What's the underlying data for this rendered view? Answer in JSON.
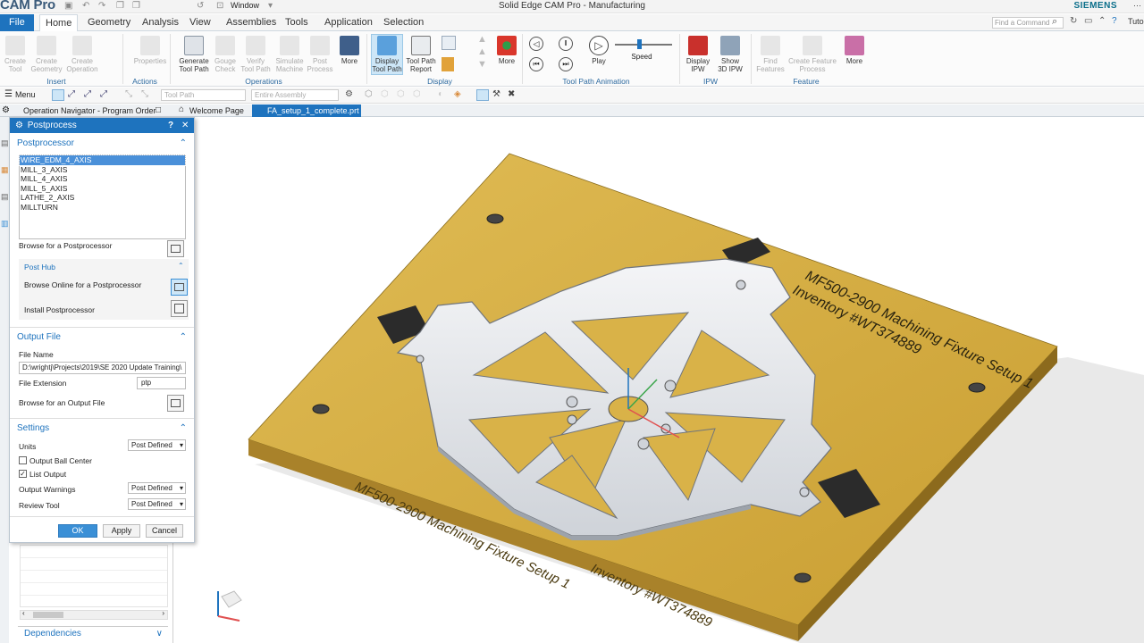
{
  "app": {
    "title": "CAM Pro",
    "window_title": "Solid Edge CAM Pro - Manufacturing",
    "brand": "SIEMENS",
    "window_menu": "Window",
    "tutorial_label": "Tuto",
    "brand_color": "#1e73be"
  },
  "menu_tabs": [
    "File",
    "Home",
    "Geometry",
    "Analysis",
    "View",
    "Assemblies",
    "Tools",
    "Application",
    "Selection"
  ],
  "command_search_placeholder": "Find a Command",
  "ribbon": {
    "buttons": [
      {
        "label": "Create\nTool",
        "enabled": false
      },
      {
        "label": "Create\nGeometry",
        "enabled": false
      },
      {
        "label": "Create\nOperation",
        "enabled": false
      },
      {
        "label": "Properties",
        "enabled": false
      },
      {
        "label": "Generate\nTool Path",
        "enabled": true
      },
      {
        "label": "Gouge\nCheck",
        "enabled": false
      },
      {
        "label": "Verify\nTool Path",
        "enabled": false
      },
      {
        "label": "Simulate\nMachine",
        "enabled": false
      },
      {
        "label": "Post\nProcess",
        "enabled": false
      },
      {
        "label": "More",
        "enabled": true
      },
      {
        "label": "Display\nTool Path",
        "enabled": true
      },
      {
        "label": "Tool Path\nReport",
        "enabled": true
      },
      {
        "label": "More",
        "enabled": true
      },
      {
        "label": "Play",
        "enabled": true
      },
      {
        "label": "Speed",
        "enabled": true
      },
      {
        "label": "Display\nIPW",
        "enabled": true
      },
      {
        "label": "Show\n3D IPW",
        "enabled": true
      },
      {
        "label": "Find\nFeatures",
        "enabled": false
      },
      {
        "label": "Create Feature\nProcess",
        "enabled": false
      },
      {
        "label": "More",
        "enabled": true
      }
    ],
    "groups": [
      "Insert",
      "Actions",
      "Operations",
      "Display",
      "Tool Path Animation",
      "IPW",
      "Feature"
    ]
  },
  "toolbar2": {
    "menu_label": "Menu",
    "filter_placeholder": "Tool Path",
    "scope_placeholder": "Entire Assembly"
  },
  "doc_tabs": {
    "navigator": "Operation Navigator - Program Order",
    "welcome": "Welcome Page",
    "part": "FA_setup_1_complete.prt"
  },
  "dialog": {
    "title": "Postprocess",
    "help": "?",
    "close": "✕",
    "postprocessor_header": "Postprocessor",
    "postprocessors": [
      "WIRE_EDM_4_AXIS",
      "MILL_3_AXIS",
      "MILL_4_AXIS",
      "MILL_5_AXIS",
      "LATHE_2_AXIS",
      "MILLTURN"
    ],
    "selected_index": 0,
    "browse_post": "Browse for a Postprocessor",
    "post_hub_header": "Post Hub",
    "browse_online": "Browse Online for a Postprocessor",
    "install_post": "Install Postprocessor",
    "output_header": "Output File",
    "file_name_label": "File Name",
    "file_name_value": "D:\\wrightj\\Projects\\2019\\SE 2020 Update Training\\",
    "file_ext_label": "File Extension",
    "file_ext_value": "ptp",
    "browse_output": "Browse for an Output File",
    "settings_header": "Settings",
    "units_label": "Units",
    "units_value": "Post Defined",
    "ball_center_label": "Output Ball Center",
    "ball_center_checked": false,
    "list_output_label": "List Output",
    "list_output_checked": true,
    "warnings_label": "Output Warnings",
    "warnings_value": "Post Defined",
    "review_label": "Review Tool",
    "review_value": "Post Defined",
    "ok": "OK",
    "apply": "Apply",
    "cancel": "Cancel"
  },
  "dependencies_label": "Dependencies",
  "model": {
    "engrave_top": "MF500-2900 Machining Fixture Setup 1",
    "engrave_inventory": "Inventory #WT374889",
    "plate_color": "#d9b248",
    "part_color": "#e4e6ea"
  }
}
